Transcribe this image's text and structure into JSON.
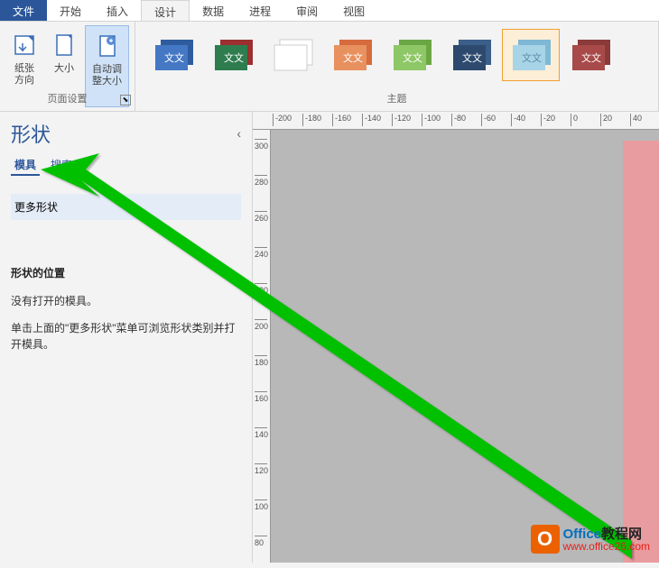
{
  "menubar": {
    "file": "文件",
    "items": [
      "开始",
      "插入",
      "设计",
      "数据",
      "进程",
      "审阅",
      "视图"
    ],
    "active_index": 2
  },
  "ribbon": {
    "page_setup": {
      "label": "页面设置",
      "orientation": "纸张方向",
      "size": "大小",
      "autofit": "自动调整大小"
    },
    "themes": {
      "label": "主题",
      "thumb_text": "文文"
    }
  },
  "shapes_panel": {
    "title": "形状",
    "tabs": {
      "stencils": "模具",
      "search": "搜索"
    },
    "more_shapes": "更多形状",
    "location_title": "形状的位置",
    "no_stencils": "没有打开的模具。",
    "hint": "单击上面的\"更多形状\"菜单可浏览形状类别并打开模具。"
  },
  "ruler": {
    "h_ticks": [
      -200,
      -180,
      -160,
      -140,
      -120,
      -100,
      -80,
      -60,
      -40,
      -20,
      0,
      20,
      40
    ],
    "v_ticks": [
      300,
      280,
      260,
      240,
      220,
      200,
      180,
      160,
      140,
      120,
      100,
      80
    ]
  },
  "watermark": {
    "line1_office": "Office",
    "line1_rest": "教程网",
    "line2": "www.office26.com",
    "icon_letter": "O"
  }
}
